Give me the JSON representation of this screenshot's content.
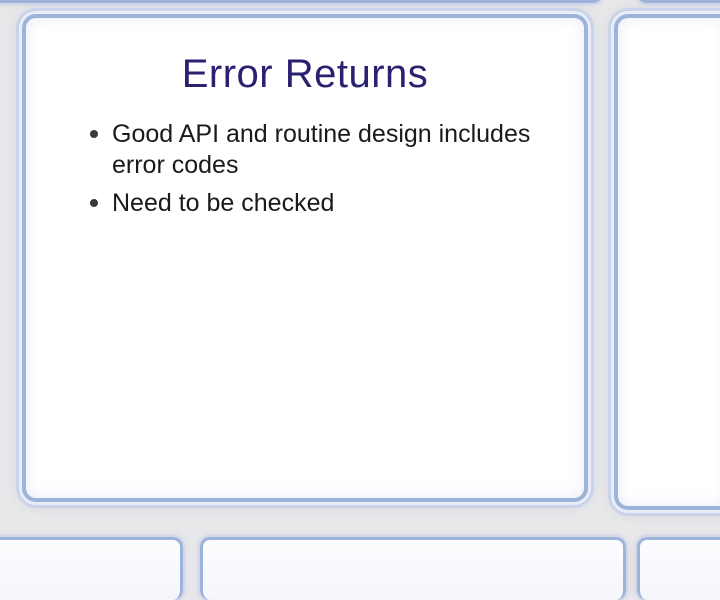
{
  "slide": {
    "title": "Error Returns",
    "bullets": [
      "Good API and routine design includes error codes",
      "Need to be checked"
    ]
  }
}
